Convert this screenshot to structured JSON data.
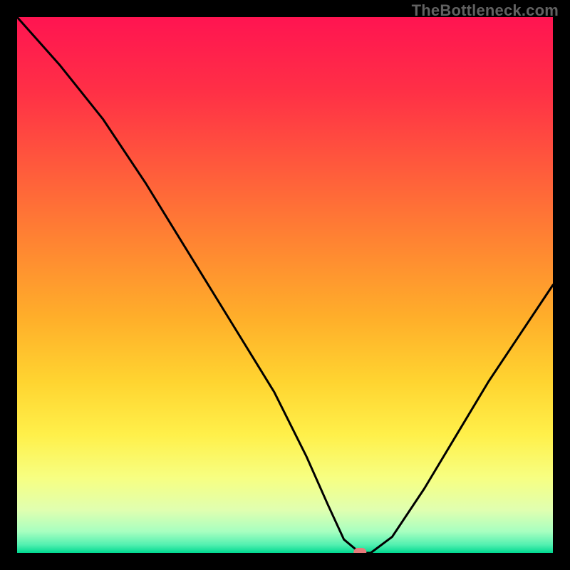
{
  "watermark": "TheBottleneck.com",
  "chart_data": {
    "type": "line",
    "title": "",
    "xlabel": "",
    "ylabel": "",
    "xlim": [
      0,
      100
    ],
    "ylim": [
      0,
      100
    ],
    "grid": false,
    "marker": {
      "x": 64,
      "y": 0,
      "color": "#e77b7b"
    },
    "series": [
      {
        "name": "bottleneck-curve",
        "color": "#000000",
        "x": [
          0,
          8,
          16,
          24,
          32,
          40,
          48,
          54,
          58,
          61,
          64,
          66,
          70,
          76,
          82,
          88,
          94,
          100
        ],
        "values": [
          100,
          91,
          81,
          69,
          56,
          43,
          30,
          18,
          9,
          2.5,
          0,
          0,
          3,
          12,
          22,
          32,
          41,
          50
        ]
      }
    ],
    "background_gradient": {
      "stops": [
        {
          "offset": 0.0,
          "color": "#ff1451"
        },
        {
          "offset": 0.14,
          "color": "#ff3046"
        },
        {
          "offset": 0.28,
          "color": "#ff5a3c"
        },
        {
          "offset": 0.42,
          "color": "#ff8432"
        },
        {
          "offset": 0.56,
          "color": "#ffae2a"
        },
        {
          "offset": 0.68,
          "color": "#ffd430"
        },
        {
          "offset": 0.78,
          "color": "#fff04a"
        },
        {
          "offset": 0.86,
          "color": "#f7ff82"
        },
        {
          "offset": 0.92,
          "color": "#e0ffb0"
        },
        {
          "offset": 0.96,
          "color": "#a8ffc0"
        },
        {
          "offset": 0.985,
          "color": "#52f0b0"
        },
        {
          "offset": 1.0,
          "color": "#00d890"
        }
      ]
    }
  }
}
